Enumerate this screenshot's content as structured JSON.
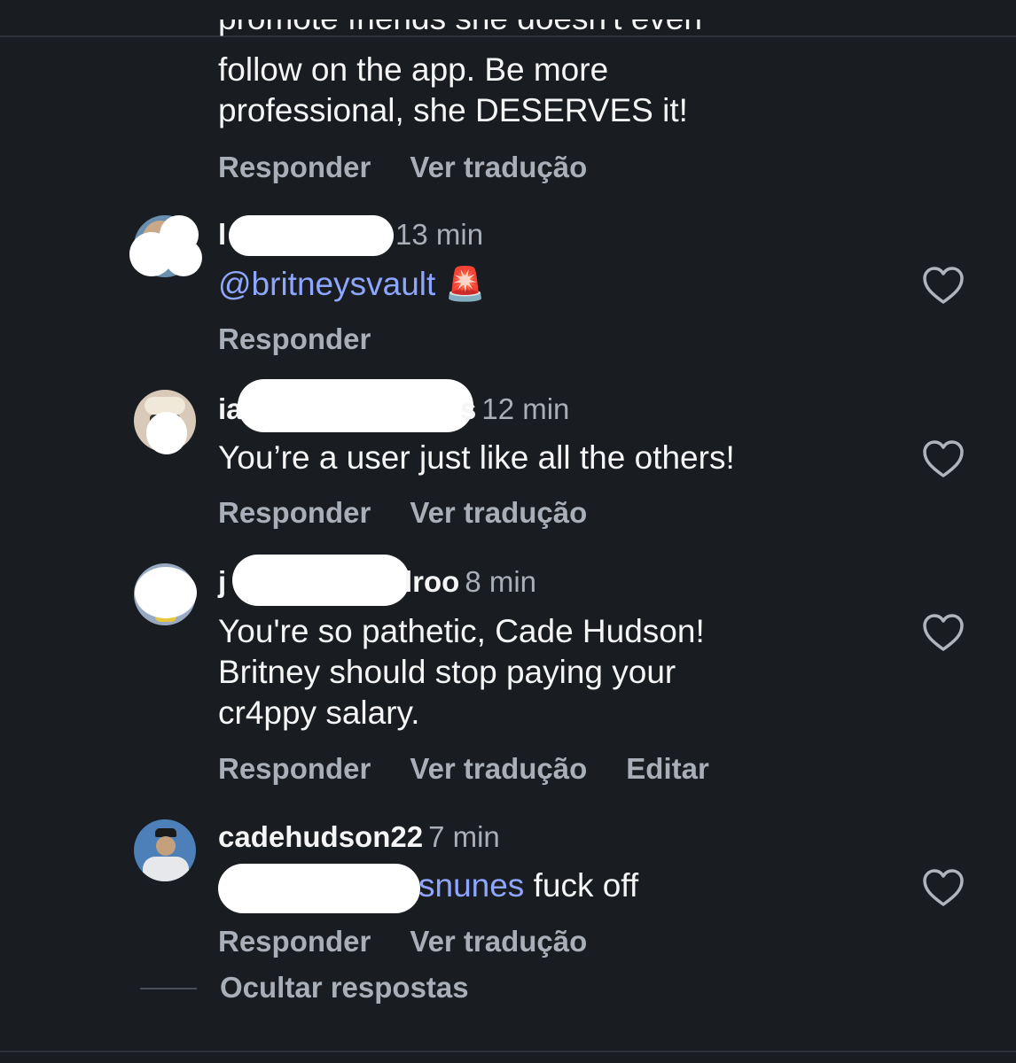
{
  "previous_comment": {
    "cut_line": "promote friends she doesn't even",
    "lines": [
      "follow on the app. Be more",
      "professional, she DESERVES it!"
    ],
    "actions": [
      "Responder",
      "Ver tradução"
    ]
  },
  "comments": [
    {
      "username_visible": "l",
      "time": "13 min",
      "mention": "@britneysvault",
      "emoji": "🚨",
      "actions": [
        "Responder"
      ]
    },
    {
      "username_visible_start": "ia",
      "username_visible_end": "s",
      "time": "12 min",
      "text": "You’re a user just like all the others!",
      "actions": [
        "Responder",
        "Ver tradução"
      ]
    },
    {
      "username_visible_start": "j",
      "username_visible_end": "lroo",
      "time": "8 min",
      "lines": [
        "You're so pathetic, Cade Hudson!",
        "Britney should stop paying your",
        "cr4ppy salary."
      ],
      "actions": [
        "Responder",
        "Ver tradução",
        "Editar"
      ]
    },
    {
      "username": "cadehudson22",
      "time": "7 min",
      "mention_visible": "snunes",
      "text": " fuck off",
      "actions": [
        "Responder",
        "Ver tradução"
      ]
    }
  ],
  "hide_replies": "Ocultar respostas",
  "colors": {
    "background": "#191c20",
    "text": "#f5f5f5",
    "secondary": "#a8afb8",
    "mention": "#8ea6ff"
  },
  "icons": {
    "like": "heart-outline-icon",
    "emoji": "siren-emoji"
  }
}
